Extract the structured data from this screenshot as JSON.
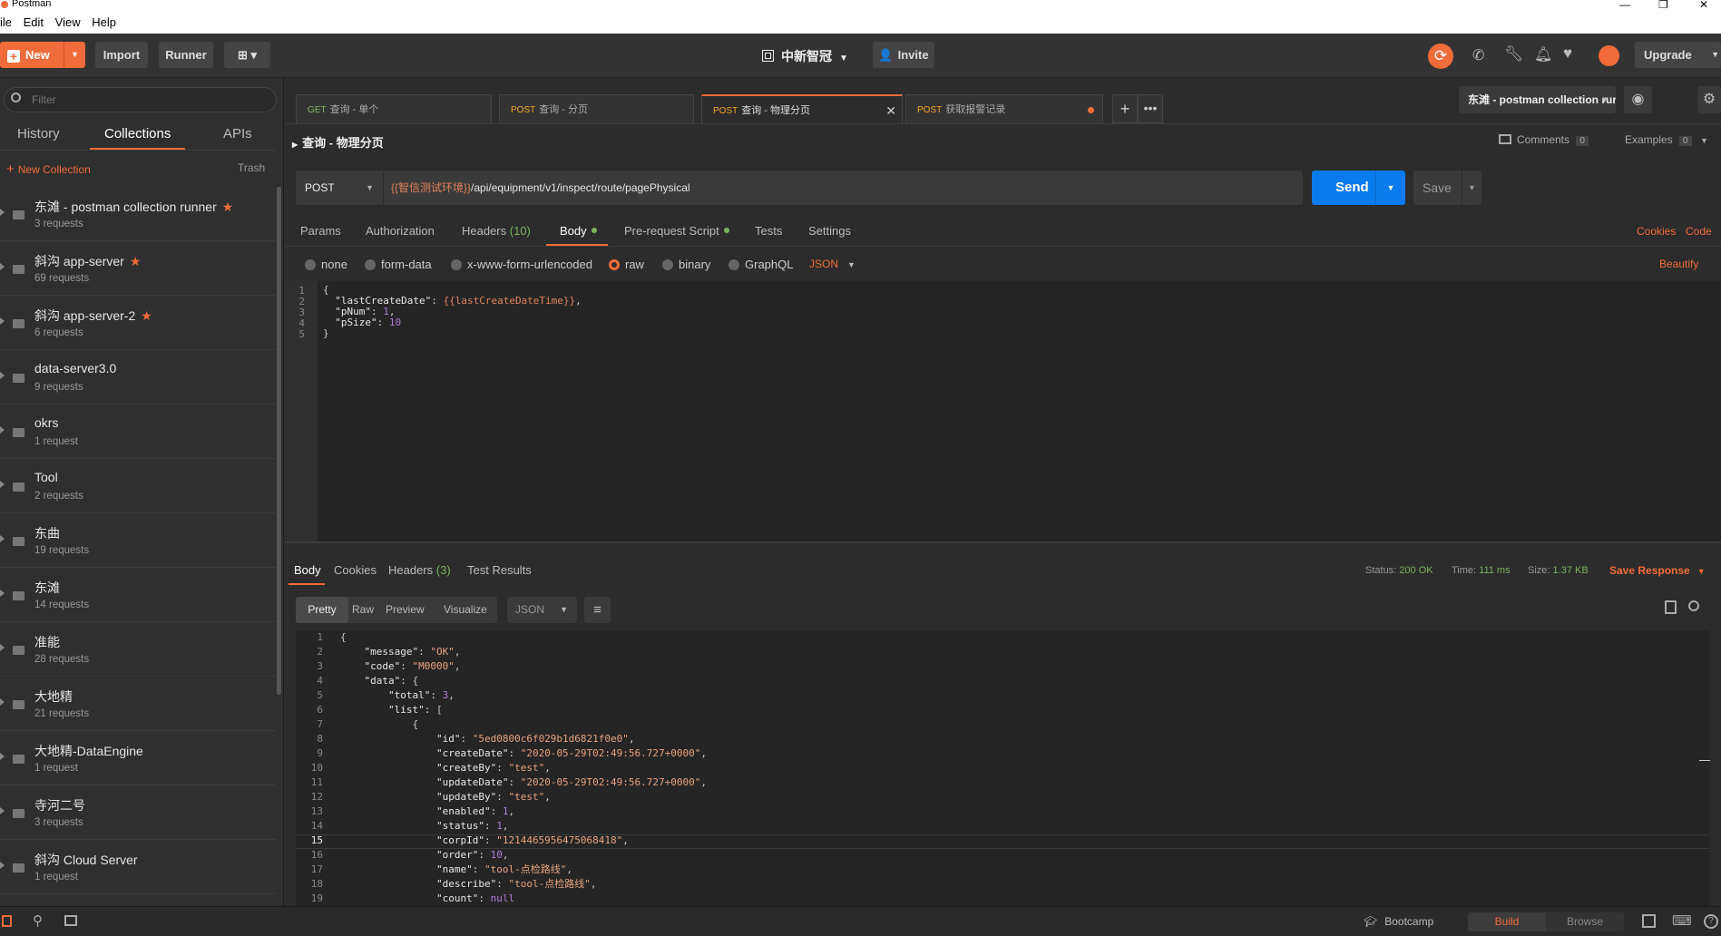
{
  "window": {
    "title": "Postman",
    "controls": [
      "—",
      "❐",
      "✕"
    ]
  },
  "menu": [
    "ile",
    "Edit",
    "View",
    "Help"
  ],
  "toolbar": {
    "new_label": "New",
    "import_label": "Import",
    "runner_label": "Runner",
    "workspace_label": "中新智冠",
    "invite_label": "Invite",
    "upgrade_label": "Upgrade"
  },
  "sidebar": {
    "filter_placeholder": "Filter",
    "tabs": [
      "History",
      "Collections",
      "APIs"
    ],
    "active_tab": "Collections",
    "new_collection_label": "New Collection",
    "trash_label": "Trash",
    "collections": [
      {
        "name": "东滩 - postman collection runner",
        "count": "3 requests",
        "starred": true
      },
      {
        "name": "斜沟 app-server",
        "count": "69 requests",
        "starred": true
      },
      {
        "name": "斜沟 app-server-2",
        "count": "6 requests",
        "starred": true
      },
      {
        "name": "data-server3.0",
        "count": "9 requests",
        "starred": false
      },
      {
        "name": "okrs",
        "count": "1 request",
        "starred": false
      },
      {
        "name": "Tool",
        "count": "2 requests",
        "starred": false
      },
      {
        "name": "东曲",
        "count": "19 requests",
        "starred": false
      },
      {
        "name": "东滩",
        "count": "14 requests",
        "starred": false
      },
      {
        "name": "准能",
        "count": "28 requests",
        "starred": false
      },
      {
        "name": "大地精",
        "count": "21 requests",
        "starred": false
      },
      {
        "name": "大地精-DataEngine",
        "count": "1 request",
        "starred": false
      },
      {
        "name": "寺河二号",
        "count": "3 requests",
        "starred": false
      },
      {
        "name": "斜沟 Cloud Server",
        "count": "1 request",
        "starred": false
      }
    ]
  },
  "tabs": [
    {
      "method": "GET",
      "name": "查询 - 单个"
    },
    {
      "method": "POST",
      "name": "查询 - 分页"
    },
    {
      "method": "POST",
      "name": "查询 - 物理分页",
      "active": true
    },
    {
      "method": "POST",
      "name": "获取报警记录",
      "unsaved": true
    }
  ],
  "environment": {
    "selected": "东滩 - postman collection rur"
  },
  "request": {
    "title": "查询 - 物理分页",
    "comments_label": "Comments",
    "comments_count": "0",
    "examples_label": "Examples",
    "examples_count": "0",
    "method": "POST",
    "url_var": "{{智信测试环境}}",
    "url_path": "/api/equipment/v1/inspect/route/pagePhysical",
    "send_label": "Send",
    "save_label": "Save"
  },
  "request_tabs": {
    "params": "Params",
    "authorization": "Authorization",
    "headers": "Headers",
    "headers_count": "(10)",
    "body": "Body",
    "prerequest": "Pre-request Script",
    "tests": "Tests",
    "settings": "Settings",
    "cookies": "Cookies",
    "code": "Code"
  },
  "body_modes": {
    "none": "none",
    "form_data": "form-data",
    "urlencoded": "x-www-form-urlencoded",
    "raw": "raw",
    "binary": "binary",
    "graphql": "GraphQL",
    "format": "JSON",
    "beautify": "Beautify"
  },
  "request_body": [
    "{",
    "  \"lastCreateDate\": {{lastCreateDateTime}},",
    "  \"pNum\": 1,",
    "  \"pSize\": 10",
    "}"
  ],
  "response": {
    "tabs": {
      "body": "Body",
      "cookies": "Cookies",
      "headers": "Headers",
      "headers_count": "(3)",
      "tests": "Test Results"
    },
    "status_label": "Status:",
    "status_value": "200 OK",
    "time_label": "Time:",
    "time_value": "111 ms",
    "size_label": "Size:",
    "size_value": "1.37 KB",
    "save_response_label": "Save Response",
    "views": [
      "Pretty",
      "Raw",
      "Preview",
      "Visualize"
    ],
    "format": "JSON",
    "lines": [
      "{",
      "    \"message\": \"OK\",",
      "    \"code\": \"M0000\",",
      "    \"data\": {",
      "        \"total\": 3,",
      "        \"list\": [",
      "            {",
      "                \"id\": \"5ed0800c6f029b1d6821f0e0\",",
      "                \"createDate\": \"2020-05-29T02:49:56.727+0000\",",
      "                \"createBy\": \"test\",",
      "                \"updateDate\": \"2020-05-29T02:49:56.727+0000\",",
      "                \"updateBy\": \"test\",",
      "                \"enabled\": 1,",
      "                \"status\": 1,",
      "                \"corpId\": \"1214465956475068418\",",
      "                \"order\": 10,",
      "                \"name\": \"tool-点检路线\",",
      "                \"describe\": \"tool-点检路线\",",
      "                \"count\": null"
    ]
  },
  "statusbar": {
    "bootcamp": "Bootcamp",
    "build": "Build",
    "browse": "Browse"
  },
  "colors": {
    "accent": "#f26b3a",
    "send": "#097bed",
    "get": "#7bb45f",
    "post": "#f5a623"
  }
}
